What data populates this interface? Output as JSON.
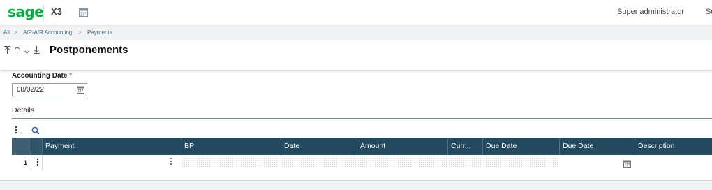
{
  "app": {
    "logo": "sage",
    "product": "X3",
    "user": "Super administrator",
    "user_extra": "Su"
  },
  "breadcrumb": [
    "All",
    "A/P-A/R Accounting",
    "Payments"
  ],
  "page": {
    "title": "Postponements",
    "nav_icons": [
      "arrow-first-icon",
      "arrow-up-icon",
      "arrow-down-icon",
      "arrow-last-icon"
    ]
  },
  "form": {
    "accounting_date_label": "Accounting Date",
    "required_mark": "*",
    "accounting_date_value": "08/02/22",
    "details_label": "Details"
  },
  "grid": {
    "columns": [
      "Payment",
      "BP",
      "Date",
      "Amount",
      "Curr...",
      "Due Date",
      "Due Date",
      "Description"
    ],
    "rows": [
      {
        "num": "1",
        "cells": [
          "",
          "",
          "",
          "",
          "",
          "",
          "",
          ""
        ]
      }
    ]
  },
  "colors": {
    "brand": "#00b140",
    "grid_header": "#234a5f",
    "required": "#e5642b"
  }
}
